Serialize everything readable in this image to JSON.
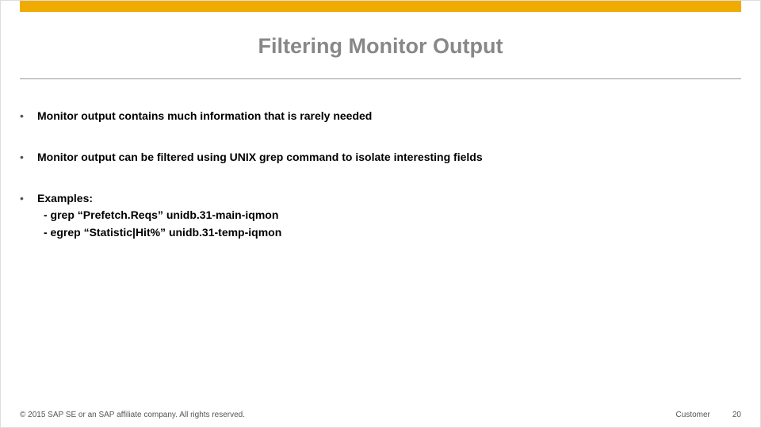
{
  "title": "Filtering Monitor Output",
  "bullets": [
    {
      "text": "Monitor output contains much information that is rarely needed",
      "subs": []
    },
    {
      "text": "Monitor output can be filtered using UNIX grep command to isolate interesting fields",
      "subs": []
    },
    {
      "text": "Examples:",
      "subs": [
        "- grep “Prefetch.Reqs” unidb.31-main-iqmon",
        "- egrep “Statistic|Hit%” unidb.31-temp-iqmon"
      ]
    }
  ],
  "footer": {
    "copyright": "© 2015 SAP SE or an SAP affiliate company. All rights reserved.",
    "classification": "Customer",
    "page": "20"
  },
  "colors": {
    "brand": "#f0ab00"
  }
}
